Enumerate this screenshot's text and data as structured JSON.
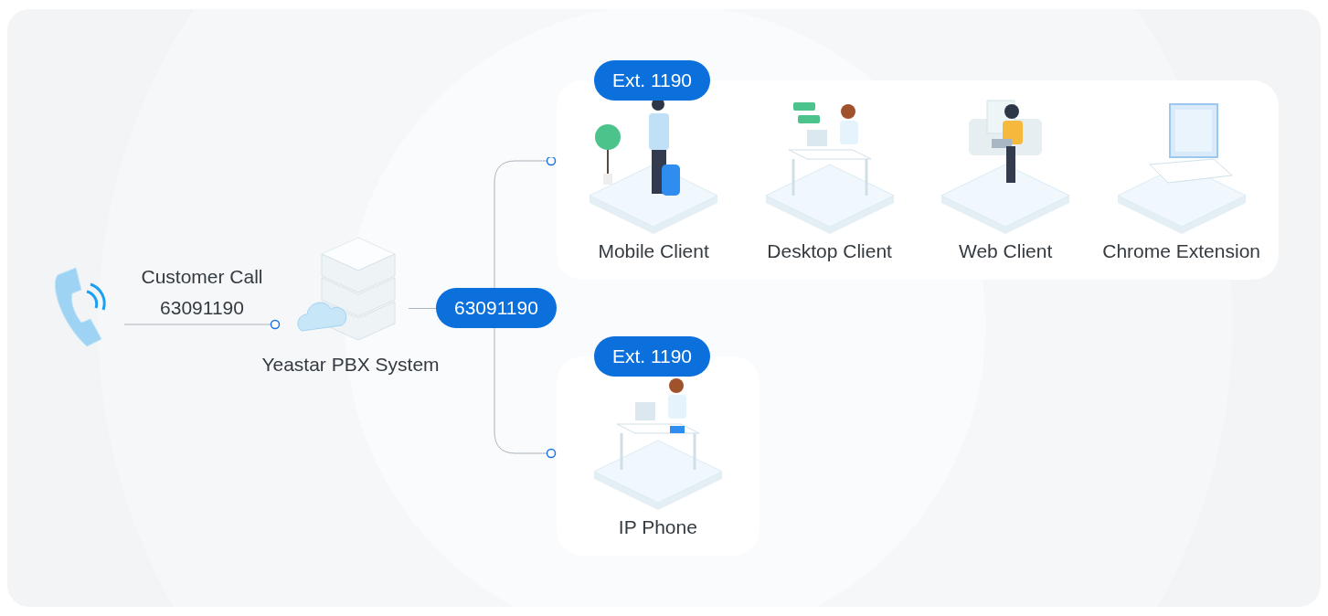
{
  "caller": {
    "label": "Customer Call",
    "number": "63091190"
  },
  "pbx": {
    "label": "Yeastar PBX System",
    "number": "63091190"
  },
  "endpoints": [
    {
      "extension": "Ext. 1190",
      "clients": [
        {
          "kind": "mobile",
          "label": "Mobile Client"
        },
        {
          "kind": "desktop",
          "label": "Desktop Client"
        },
        {
          "kind": "web",
          "label": "Web Client"
        },
        {
          "kind": "extension",
          "label": "Chrome Extension"
        }
      ]
    },
    {
      "extension": "Ext. 1190",
      "clients": [
        {
          "kind": "phone",
          "label": "IP Phone"
        }
      ]
    }
  ]
}
